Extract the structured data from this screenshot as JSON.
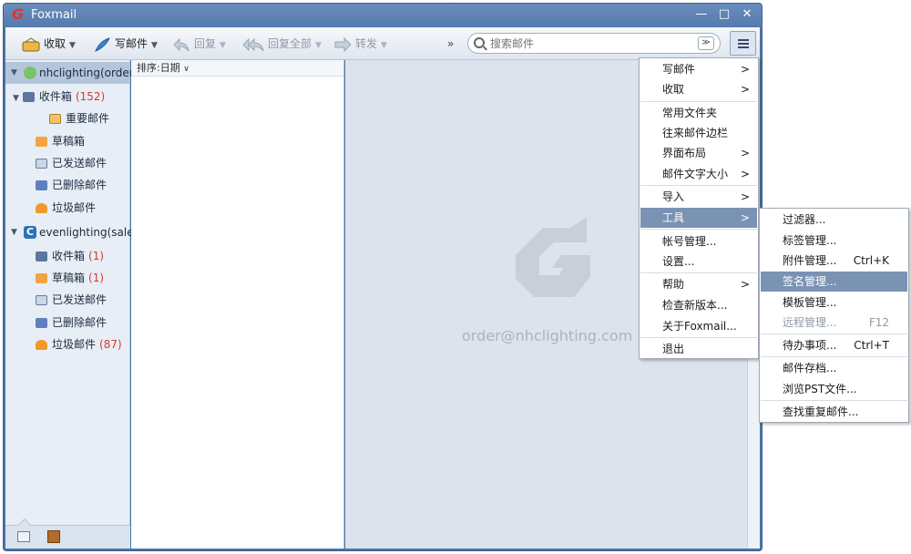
{
  "app": {
    "title": "Foxmail"
  },
  "toolbar": {
    "receive": "收取",
    "compose": "写邮件",
    "reply": "回复",
    "reply_all": "回复全部",
    "forward": "转发",
    "more": "»",
    "search_placeholder": "搜索邮件"
  },
  "sidebar": {
    "accounts": [
      {
        "name": "nhclighting(order)",
        "folders": [
          {
            "label": "收件箱",
            "count": "(152)"
          },
          {
            "label": "重要邮件",
            "count": ""
          },
          {
            "label": "草稿箱",
            "count": ""
          },
          {
            "label": "已发送邮件",
            "count": ""
          },
          {
            "label": "已删除邮件",
            "count": ""
          },
          {
            "label": "垃圾邮件",
            "count": ""
          }
        ]
      },
      {
        "name": "evenlighting(sales)",
        "folders": [
          {
            "label": "收件箱",
            "count": "(1)"
          },
          {
            "label": "草稿箱",
            "count": "(1)"
          },
          {
            "label": "已发送邮件",
            "count": ""
          },
          {
            "label": "已删除邮件",
            "count": ""
          },
          {
            "label": "垃圾邮件",
            "count": "(87)"
          }
        ]
      }
    ]
  },
  "maillist": {
    "sort_label": "排序:日期"
  },
  "preview": {
    "account_email": "order@nhclighting.com"
  },
  "main_menu": {
    "items": [
      {
        "label": "写邮件"
      },
      {
        "label": "收取"
      },
      {
        "label": "常用文件夹"
      },
      {
        "label": "往来邮件边栏"
      },
      {
        "label": "界面布局"
      },
      {
        "label": "邮件文字大小"
      },
      {
        "label": "导入"
      },
      {
        "label": "工具"
      },
      {
        "label": "帐号管理..."
      },
      {
        "label": "设置..."
      },
      {
        "label": "帮助"
      },
      {
        "label": "检查新版本..."
      },
      {
        "label": "关于Foxmail..."
      },
      {
        "label": "退出"
      }
    ],
    "submenu_arrow": ">"
  },
  "tools_menu": {
    "items": [
      {
        "label": "过滤器...",
        "shortcut": ""
      },
      {
        "label": "标签管理...",
        "shortcut": ""
      },
      {
        "label": "附件管理...",
        "shortcut": "Ctrl+K"
      },
      {
        "label": "签名管理...",
        "shortcut": ""
      },
      {
        "label": "模板管理...",
        "shortcut": ""
      },
      {
        "label": "远程管理...",
        "shortcut": "F12"
      },
      {
        "label": "待办事项...",
        "shortcut": "Ctrl+T"
      },
      {
        "label": "邮件存档...",
        "shortcut": ""
      },
      {
        "label": "浏览PST文件...",
        "shortcut": ""
      },
      {
        "label": "查找重复邮件...",
        "shortcut": ""
      }
    ]
  },
  "colors": {
    "accent": "#4e74a6",
    "highlight": "#7a93b3",
    "unread_count": "#d23b32"
  }
}
